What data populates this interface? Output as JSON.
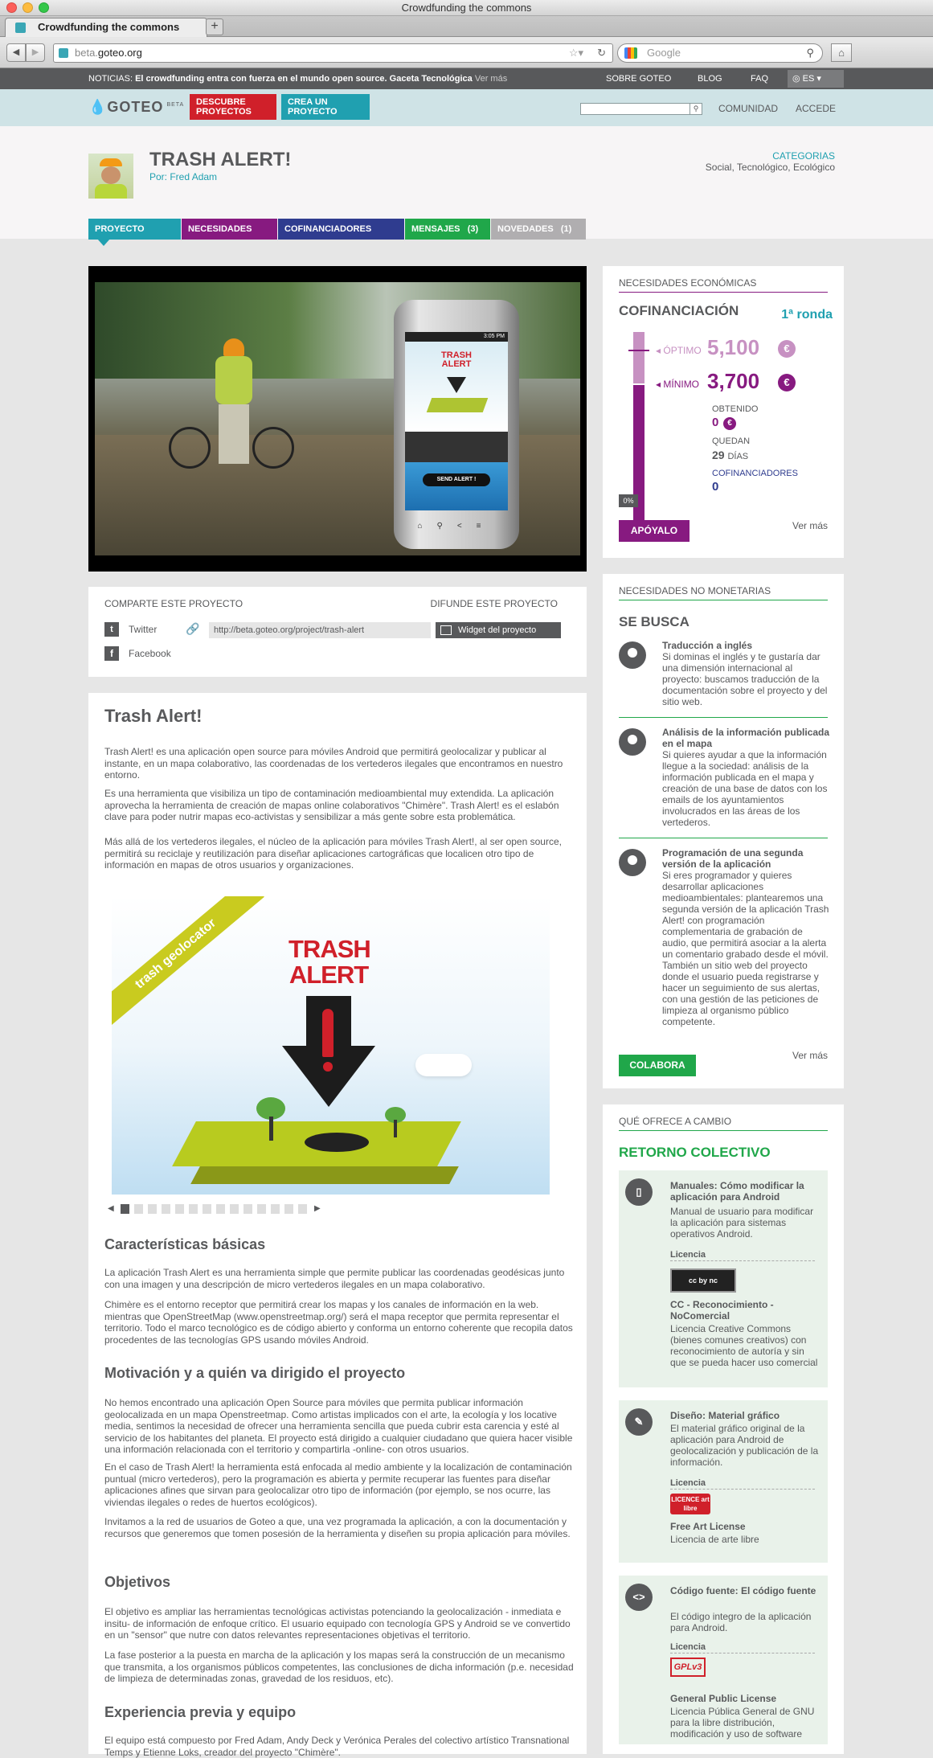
{
  "browser": {
    "window_title": "Crowdfunding the commons",
    "tab_title": "Crowdfunding the commons",
    "new_tab": "+",
    "url_prefix": "beta.",
    "url_domain": "goteo.org",
    "search_placeholder": "Google"
  },
  "news": {
    "label": "NOTICIAS:",
    "text": "El crowdfunding entra con fuerza en el mundo open source. Gaceta Tecnológica",
    "more": "Ver más",
    "links": [
      "SOBRE GOTEO",
      "BLOG",
      "FAQ"
    ],
    "lang": "ES"
  },
  "header": {
    "logo": "GOTEO",
    "beta": "BETA",
    "discover": "DESCUBRE PROYECTOS",
    "create": "CREA UN PROYECTO",
    "community": "COMUNIDAD",
    "login": "ACCEDE"
  },
  "project": {
    "title": "TRASH ALERT!",
    "by": "Por: Fred Adam",
    "categories_label": "CATEGORIAS",
    "categories": "Social, Tecnológico, Ecológico",
    "tabs": [
      {
        "label": "PROYECTO",
        "count": ""
      },
      {
        "label": "NECESIDADES",
        "count": ""
      },
      {
        "label": "COFINANCIADORES",
        "count": ""
      },
      {
        "label": "MENSAJES",
        "count": "(3)"
      },
      {
        "label": "NOVEDADES",
        "count": "(1)"
      }
    ]
  },
  "phone": {
    "time": "3:05 PM",
    "title1": "TRASH",
    "title2": "ALERT",
    "send": "SEND ALERT !"
  },
  "share": {
    "label": "COMPARTE ESTE PROYECTO",
    "twitter": "Twitter",
    "facebook": "Facebook",
    "spread_label": "DIFUNDE ESTE PROYECTO",
    "url": "http://beta.goteo.org/project/trash-alert",
    "widget": "Widget del proyecto"
  },
  "funding": {
    "header": "NECESIDADES ECONÓMICAS",
    "title": "COFINANCIACIÓN",
    "round": "1ª ronda",
    "optimum_label": "ÓPTIMO",
    "optimum": "5,100",
    "minimum_label": "MÍNIMO",
    "minimum": "3,700",
    "currency": "€",
    "obtained_label": "OBTENIDO",
    "obtained": "0",
    "remaining_label": "QUEDAN",
    "remaining": "29",
    "days": "DÍAS",
    "backers_label": "COFINANCIADORES",
    "backers": "0",
    "percent": "0%",
    "progress_fraction": 0,
    "support": "APÓYALO",
    "more": "Ver más"
  },
  "needs": {
    "header": "NECESIDADES NO MONETARIAS",
    "title": "SE BUSCA",
    "items": [
      {
        "title": "Traducción a inglés",
        "text": "Si dominas el inglés y te gustaría dar una dimensión internacional al proyecto: buscamos traducción de la documentación sobre el proyecto y del sitio web."
      },
      {
        "title": "Análisis de la información publicada en el mapa",
        "text": "Si quieres ayudar a que la información llegue a la sociedad: análisis de la información publicada en el mapa y creación de una base de datos con los emails de los ayuntamientos involucrados en las áreas de los vertederos."
      },
      {
        "title": "Programación de una segunda versión de la aplicación",
        "text": "Si eres programador y quieres desarrollar aplicaciones medioambientales: plantearemos una segunda versión de la aplicación Trash Alert! con programación complementaria de grabación de audio, que permitirá asociar a la alerta un comentario grabado desde el móvil. También un sitio web del proyecto donde el usuario pueda registrarse y hacer un seguimiento de sus alertas, con una gestión de las peticiones de limpieza al organismo público competente."
      }
    ],
    "button": "COLABORA",
    "more": "Ver más"
  },
  "rewards": {
    "header": "QUÉ OFRECE A CAMBIO",
    "title": "RETORNO COLECTIVO",
    "license_label": "Licencia",
    "items": [
      {
        "title": "Manuales: Cómo modificar la aplicación para Android",
        "text": "Manual de usuario para modificar la aplicación para sistemas operativos Android.",
        "badge": "cc by nc",
        "license_name": "CC - Reconocimiento - NoComercial",
        "license_text": "Licencia Creative Commons (bienes comunes creativos) con reconocimiento de autoría y sin que se pueda hacer uso comercial"
      },
      {
        "title": "Diseño: Material gráfico",
        "text": "El material gráfico original de la aplicación para Android de geolocalización y publicación de la información.",
        "badge": "LICENCE art libre",
        "license_name": "Free Art License",
        "license_text": "Licencia de arte libre"
      },
      {
        "title": "Código fuente: El código fuente",
        "text": "El código integro de la aplicación para Android.",
        "badge": "GPLv3",
        "license_name": "General Public License",
        "license_text": "Licencia Pública General de GNU para la libre distribución, modificación y uso de software"
      }
    ]
  },
  "content": {
    "title": "Trash Alert!",
    "intro": [
      "Trash Alert! es una aplicación open source para móviles Android que permitirá geolocalizar y publicar al instante, en un mapa colaborativo, las coordenadas de los vertederos ilegales que encontramos en nuestro entorno.",
      "Es una herramienta que visibiliza un tipo de contaminación medioambiental muy extendida. La aplicación aprovecha la herramienta de creación de mapas online colaborativos \"Chimère\". Trash Alert! es el eslabón clave para poder nutrir mapas eco-activistas y sensibilizar a más gente sobre esta problemática.",
      "Más allá de los vertederos ilegales, el núcleo de la aplicación para móviles Trash Alert!, al ser open source, permitirá su reciclaje y reutilización para diseñar aplicaciones cartográficas que localicen otro tipo de información en mapas de otros usuarios y organizaciones."
    ],
    "banner_ribbon": "trash geolocator",
    "banner_title1": "TRASH",
    "banner_title2": "ALERT",
    "sections": [
      {
        "title": "Características básicas",
        "paras": [
          "La aplicación Trash Alert es una herramienta simple que permite publicar las coordenadas geodésicas junto con una imagen y una descripción de micro vertederos ilegales en un mapa colaborativo.",
          "Chimère es el entorno receptor que permitirá crear los mapas y los canales de información en la web. mientras que OpenStreetMap (www.openstreetmap.org/) será el mapa receptor que permita representar el territorio. Todo el marco tecnológico es de código abierto y conforma un entorno coherente que recopila datos procedentes de las tecnologías GPS usando móviles Android."
        ]
      },
      {
        "title": "Motivación y a quién va dirigido el proyecto",
        "paras": [
          "No hemos encontrado una aplicación Open Source para móviles que permita publicar información geolocalizada en un mapa Openstreetmap. Como artistas implicados con el arte, la ecología y los locative media, sentimos la necesidad de ofrecer una herramienta sencilla que pueda cubrir esta carencia y esté al servicio de los habitantes del planeta. El proyecto está dirigido a cualquier ciudadano que quiera hacer visible una información relacionada con el territorio y compartirla -online- con otros usuarios.",
          "En el caso de Trash Alert! la herramienta está enfocada al medio ambiente y la localización de contaminación puntual (micro vertederos), pero la programación es abierta y permite recuperar las fuentes para diseñar aplicaciones afines que sirvan para geolocalizar otro tipo de información (por ejemplo, se nos ocurre, las viviendas ilegales o redes de huertos ecológicos).",
          "Invitamos a la red de usuarios de Goteo a que, una vez programada la aplicación, a con la documentación y recursos que generemos que tomen posesión de la herramienta y diseñen su propia aplicación para móviles."
        ]
      },
      {
        "title": "Objetivos",
        "paras": [
          "El objetivo es ampliar las herramientas tecnológicas activistas potenciando la geolocalización - inmediata e insitu- de información de enfoque crítico. El usuario equipado con tecnología GPS y Android se ve convertido en un \"sensor\" que nutre con datos relevantes representaciones objetivas el territorio.",
          "La fase posterior a la puesta en marcha de la aplicación y los mapas será la construcción de un mecanismo que transmita, a los organismos públicos competentes, las conclusiones de dicha información (p.e. necesidad de limpieza de determinadas zonas, gravedad de los residuos, etc)."
        ]
      },
      {
        "title": "Experiencia previa y equipo",
        "paras": [
          "El equipo está compuesto por Fred Adam, Andy Deck y Verónica Perales del colectivo artístico Transnational Temps y Etienne Loks, creador del proyecto \"Chimère\"."
        ]
      }
    ]
  },
  "colors": {
    "teal": "#20a0b0",
    "purple": "#871a80",
    "green": "#20a74a",
    "red": "#d0202a",
    "dark": "#58595b"
  }
}
